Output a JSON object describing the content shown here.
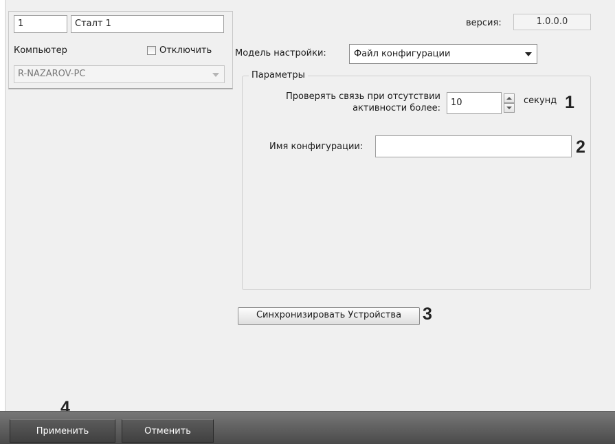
{
  "device": {
    "id": "1",
    "name": "Сталт 1",
    "computer_label": "Компьютер",
    "disable_label": "Отключить",
    "computer_value": "R-NAZAROV-PC"
  },
  "version": {
    "label": "версия:",
    "value": "1.0.0.0"
  },
  "settings_model": {
    "label": "Модель настройки:",
    "value": "Файл конфигурации"
  },
  "params": {
    "legend": "Параметры",
    "check_link_label_line1": "Проверять связь при отсутствии",
    "check_link_label_line2": "активности более:",
    "check_link_value": "10",
    "check_link_unit": "секунд",
    "config_name_label": "Имя конфигурации:",
    "config_name_value": ""
  },
  "sync_button": "Синхронизировать Устройства",
  "markers": [
    "1",
    "2",
    "3",
    "4"
  ],
  "footer": {
    "apply": "Применить",
    "cancel": "Отменить"
  },
  "icons": {
    "dropdown": "chevron-down-icon",
    "spin_up": "arrow-up-icon",
    "spin_down": "arrow-down-icon"
  }
}
